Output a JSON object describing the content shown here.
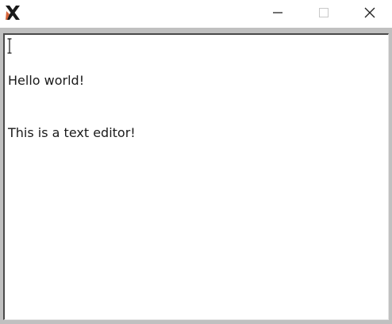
{
  "window": {
    "app_icon": "x-window-system-icon",
    "buttons": {
      "minimize_icon": "minimize-icon",
      "maximize_icon": "maximize-icon",
      "close_icon": "close-icon"
    }
  },
  "editor": {
    "lines": [
      "Hello world!",
      "This is a text editor!"
    ],
    "cursor_icon": "text-cursor-icon"
  },
  "colors": {
    "titlebar": "#ffffff",
    "frame": "#c0c0c0",
    "editor_bg": "#ffffff",
    "text": "#1a1a1a"
  }
}
